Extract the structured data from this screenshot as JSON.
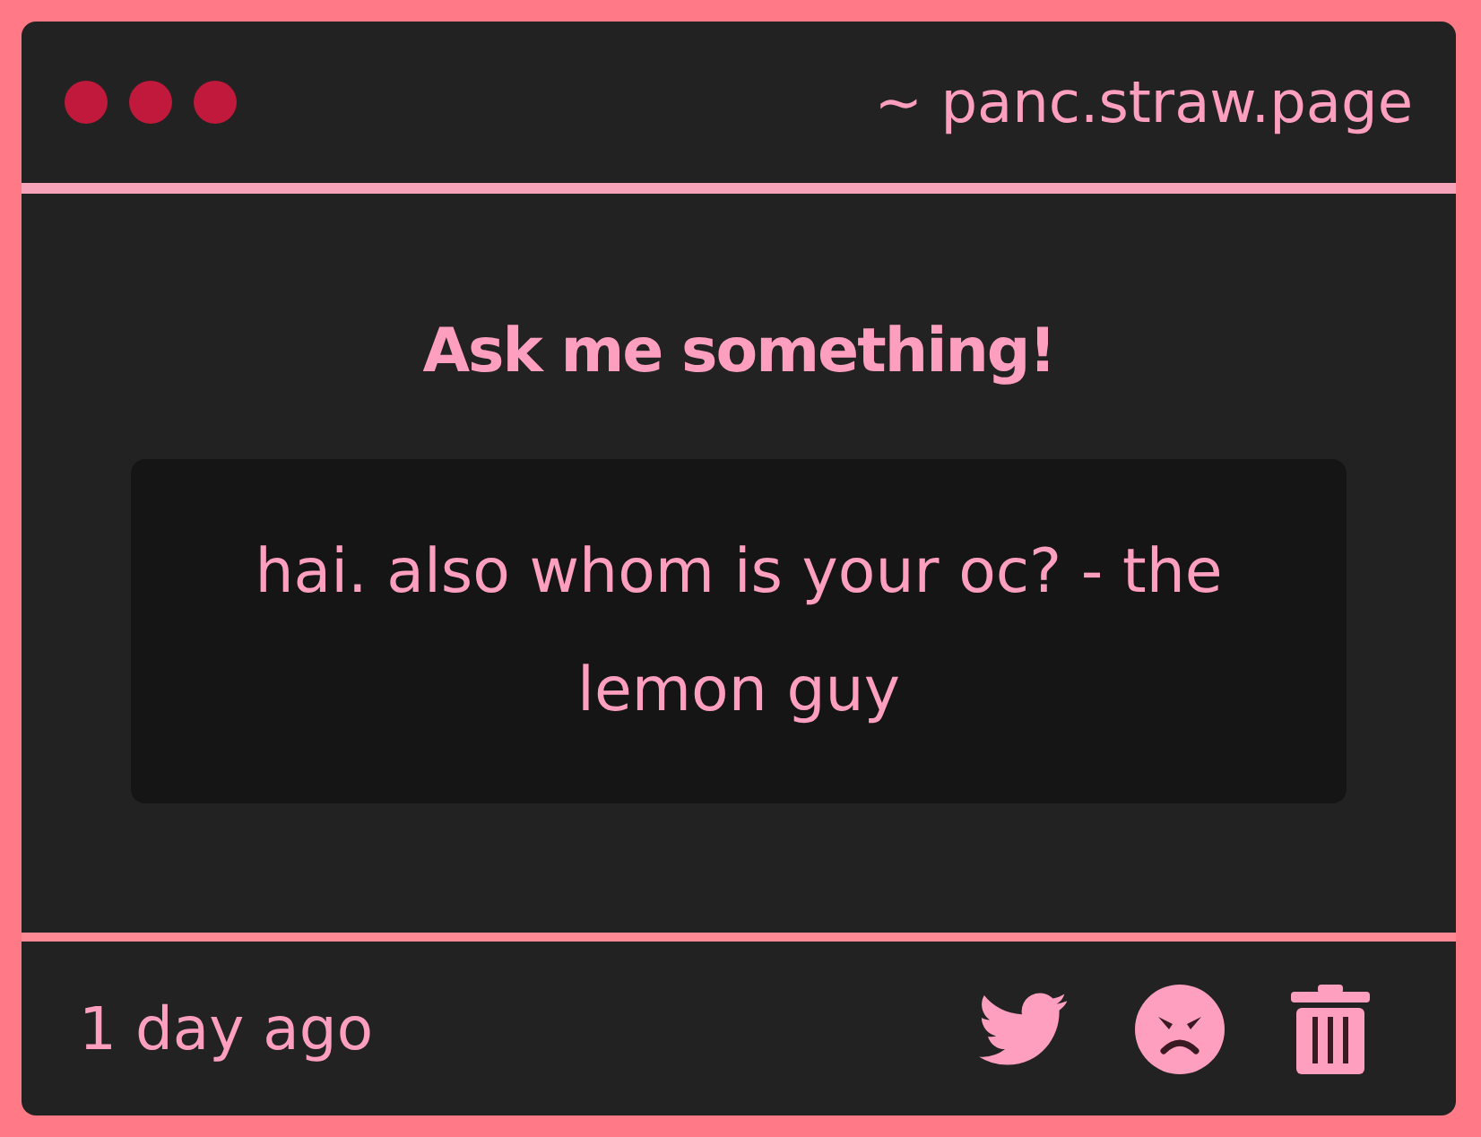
{
  "window": {
    "title": "~ panc.straw.page"
  },
  "prompt": "Ask me something!",
  "question": "hai. also whom is your oc? - the lemon guy",
  "footer": {
    "time": "1 day ago"
  }
}
